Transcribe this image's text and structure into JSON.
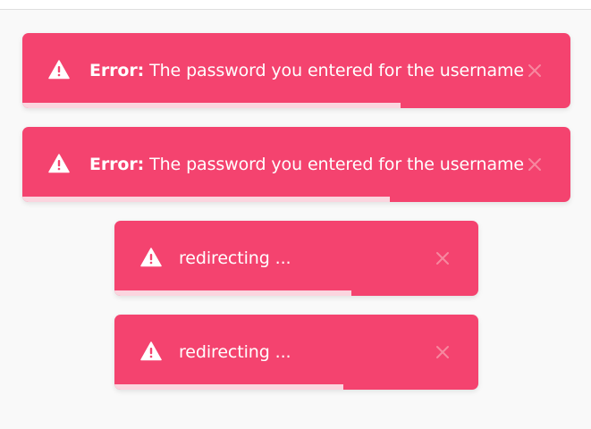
{
  "colors": {
    "toast_bg": "#f4436f",
    "progress": "#fbd5df",
    "page_bg": "#f9f9f9"
  },
  "icons": {
    "status": "warning-icon",
    "close": "close-icon"
  },
  "toasts": [
    {
      "label": "Error",
      "separator": ":",
      "message": " The password you entered for the username",
      "progress": 0.69
    },
    {
      "label": "Error",
      "separator": ":",
      "message": " The password you entered for the username",
      "progress": 0.67
    },
    {
      "label": "",
      "separator": "",
      "message": "redirecting ...",
      "progress": 0.65
    },
    {
      "label": "",
      "separator": "",
      "message": "redirecting ...",
      "progress": 0.63
    }
  ]
}
